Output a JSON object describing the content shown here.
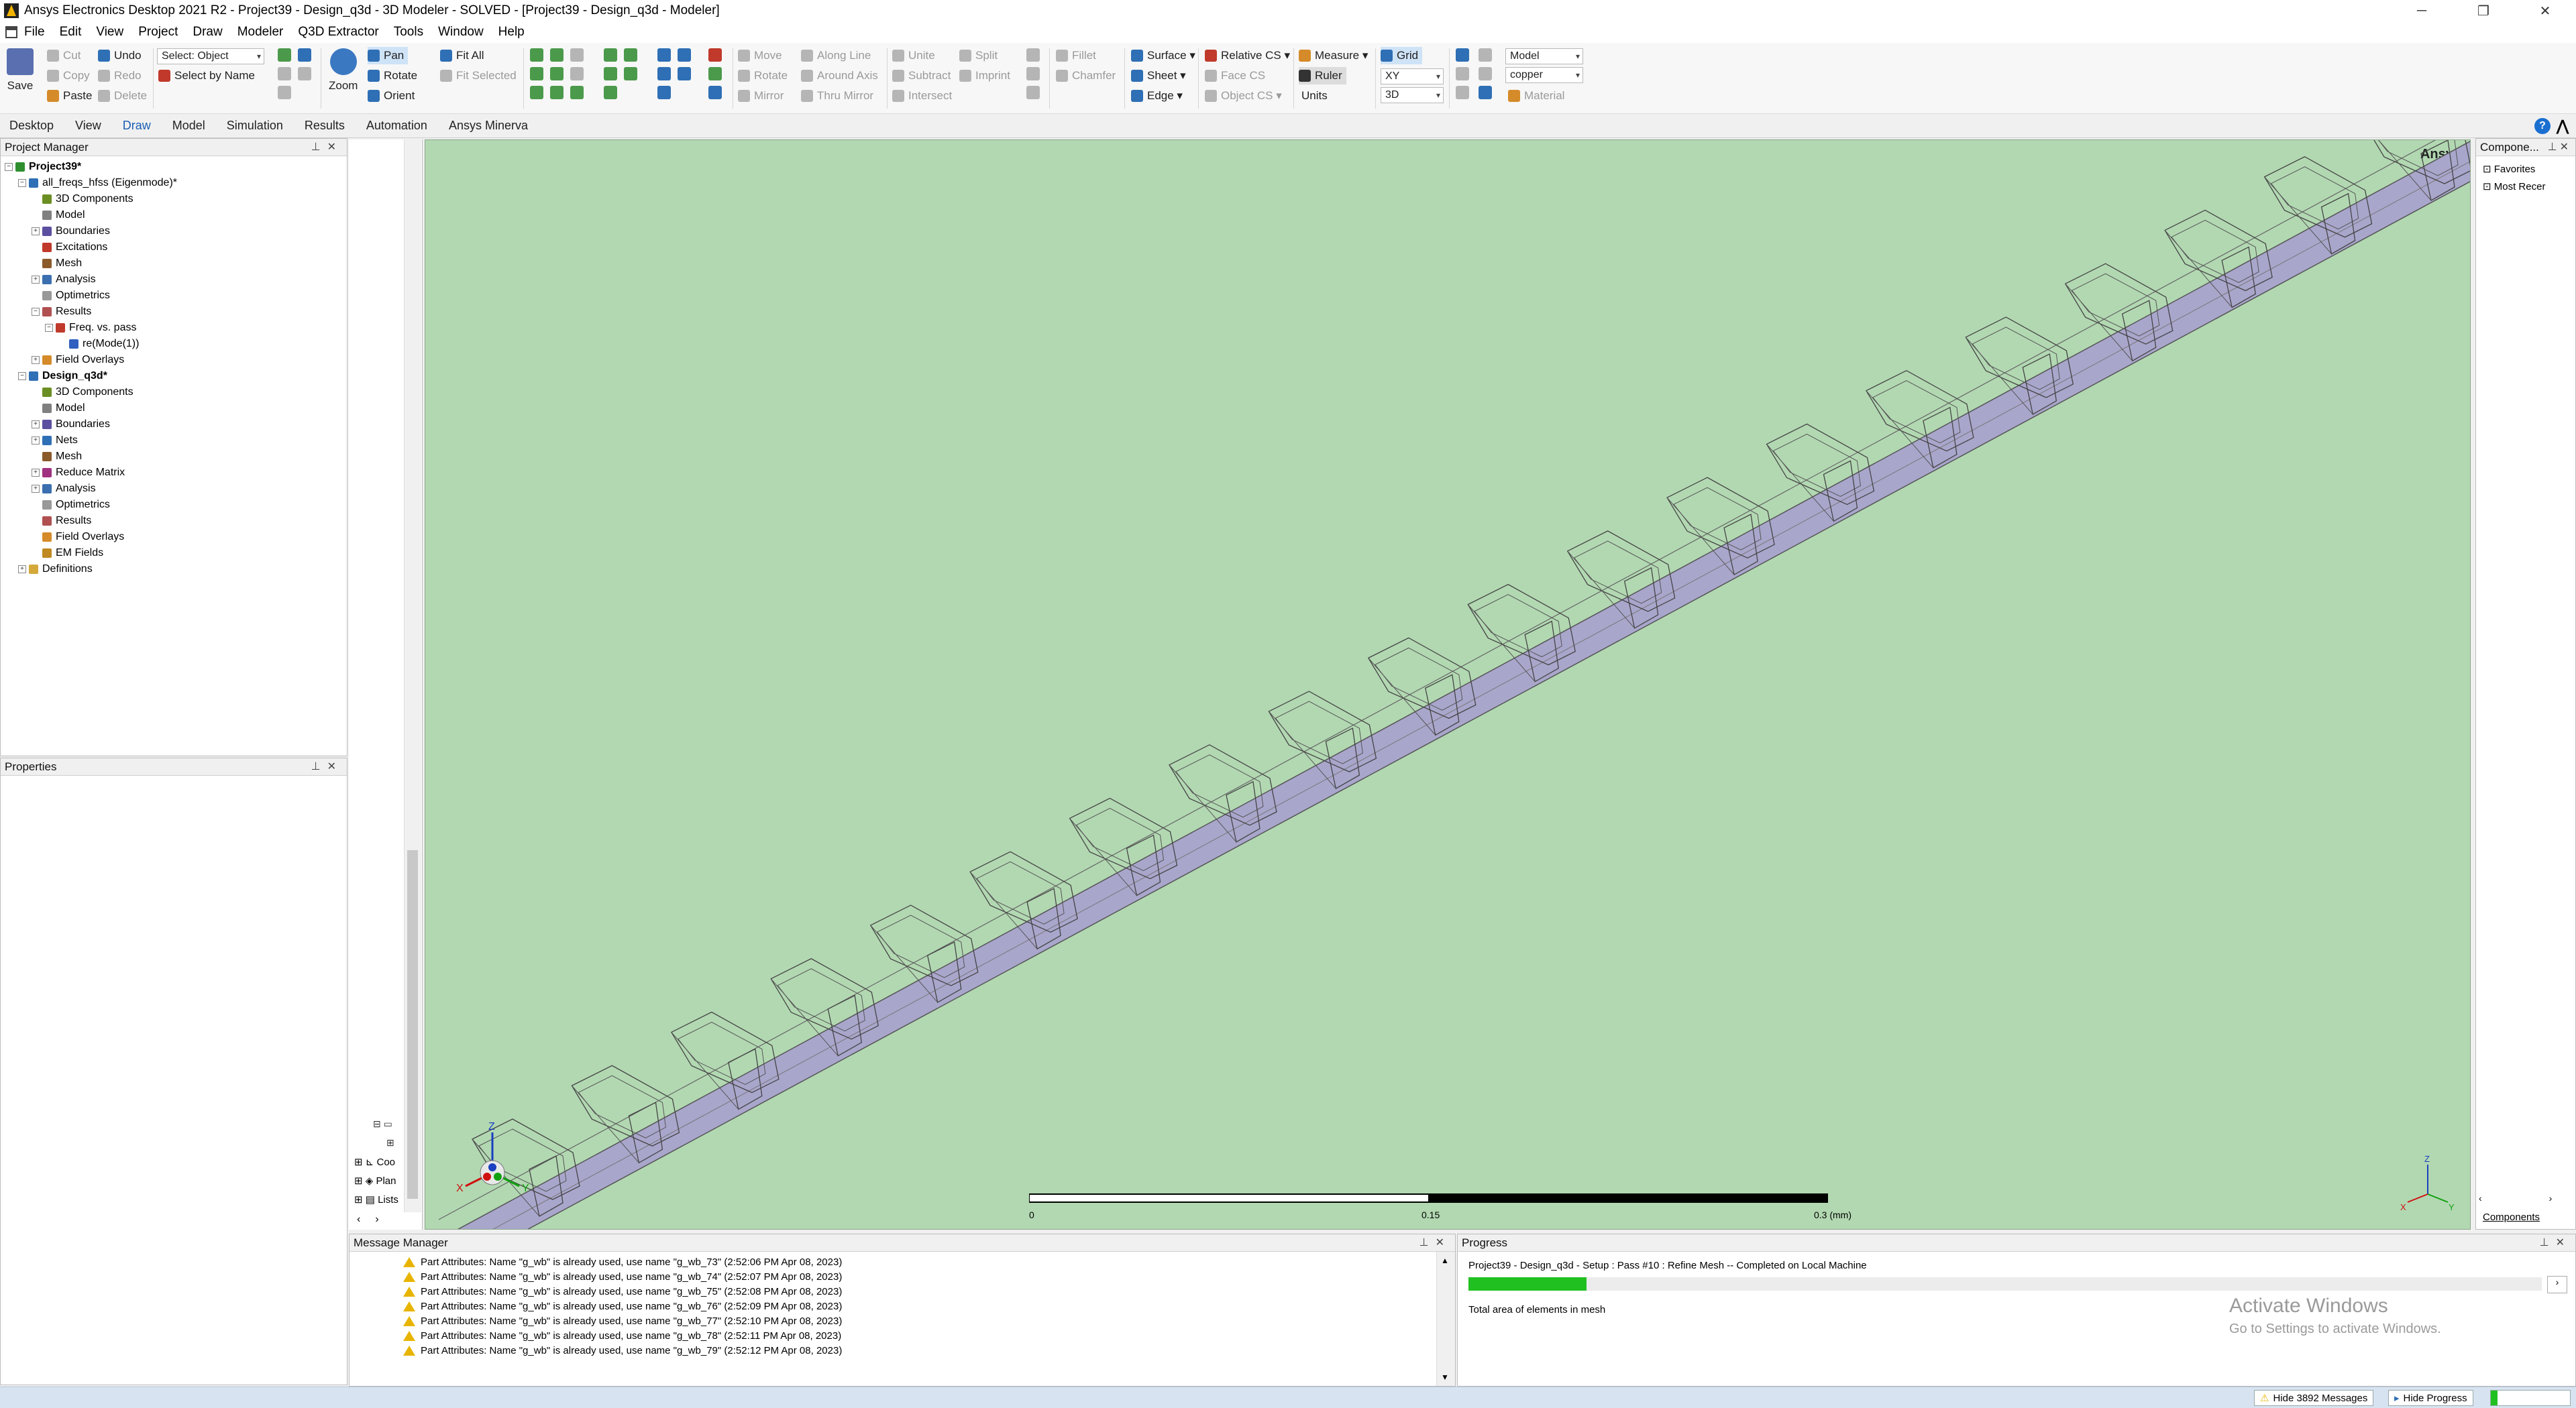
{
  "window": {
    "title": "Ansys Electronics Desktop 2021 R2 - Project39 - Design_q3d - 3D Modeler - SOLVED - [Project39 - Design_q3d - Modeler]",
    "controls": [
      "─",
      "❐",
      "✕"
    ]
  },
  "menu": [
    "File",
    "Edit",
    "View",
    "Project",
    "Draw",
    "Modeler",
    "Q3D Extractor",
    "Tools",
    "Window",
    "Help"
  ],
  "ribbon": {
    "save": "Save",
    "cut": "Cut",
    "copy": "Copy",
    "paste": "Paste",
    "undo": "Undo",
    "redo": "Redo",
    "delete": "Delete",
    "select_mode": "Select: Object",
    "select_by_name": "Select by Name",
    "zoom": "Zoom",
    "pan": "Pan",
    "rotate": "Rotate",
    "orient": "Orient",
    "fit_all": "Fit All",
    "fit_selected": "Fit Selected",
    "move": "Move",
    "rotate2": "Rotate",
    "mirror": "Mirror",
    "along_line": "Along Line",
    "around_axis": "Around Axis",
    "thru_mirror": "Thru Mirror",
    "unite": "Unite",
    "subtract": "Subtract",
    "intersect": "Intersect",
    "split": "Split",
    "imprint": "Imprint",
    "fillet": "Fillet",
    "chamfer": "Chamfer",
    "surface": "Surface",
    "sheet": "Sheet",
    "edge": "Edge",
    "relative_cs": "Relative CS",
    "face_cs": "Face CS",
    "object_cs": "Object CS",
    "measure": "Measure",
    "ruler": "Ruler",
    "units": "Units",
    "grid": "Grid",
    "plane": "XY",
    "view_mode": "3D",
    "model": "Model",
    "material_value": "copper",
    "material": "Material"
  },
  "tabs": [
    "Desktop",
    "View",
    "Draw",
    "Model",
    "Simulation",
    "Results",
    "Automation",
    "Ansys Minerva"
  ],
  "active_tab": "Draw",
  "project_manager": {
    "title": "Project Manager",
    "items": [
      {
        "label": "Project39*",
        "depth": 0,
        "icon": "#2f8f2f",
        "bold": true,
        "exp": "⊟"
      },
      {
        "label": "all_freqs_hfss (Eigenmode)*",
        "depth": 1,
        "icon": "#2f6fb5",
        "exp": "⊟"
      },
      {
        "label": "3D Components",
        "depth": 2,
        "icon": "#6b8e23",
        "exp": ""
      },
      {
        "label": "Model",
        "depth": 2,
        "icon": "#808080",
        "exp": ""
      },
      {
        "label": "Boundaries",
        "depth": 2,
        "icon": "#5b4fa0",
        "exp": "⊞"
      },
      {
        "label": "Excitations",
        "depth": 2,
        "icon": "#c0392b",
        "exp": ""
      },
      {
        "label": "Mesh",
        "depth": 2,
        "icon": "#8b5a2b",
        "exp": ""
      },
      {
        "label": "Analysis",
        "depth": 2,
        "icon": "#3b6fb0",
        "exp": "⊞"
      },
      {
        "label": "Optimetrics",
        "depth": 2,
        "icon": "#999999",
        "exp": ""
      },
      {
        "label": "Results",
        "depth": 2,
        "icon": "#b05050",
        "exp": "⊟"
      },
      {
        "label": "Freq. vs. pass",
        "depth": 3,
        "icon": "#c0392b",
        "exp": "⊟"
      },
      {
        "label": "re(Mode(1))",
        "depth": 4,
        "icon": "#3060c0",
        "exp": ""
      },
      {
        "label": "Field Overlays",
        "depth": 2,
        "icon": "#d58b2a",
        "exp": "⊞"
      },
      {
        "label": "Design_q3d*",
        "depth": 1,
        "icon": "#2f6fb5",
        "bold": true,
        "exp": "⊟"
      },
      {
        "label": "3D Components",
        "depth": 2,
        "icon": "#6b8e23",
        "exp": ""
      },
      {
        "label": "Model",
        "depth": 2,
        "icon": "#808080",
        "exp": ""
      },
      {
        "label": "Boundaries",
        "depth": 2,
        "icon": "#5b4fa0",
        "exp": "⊞"
      },
      {
        "label": "Nets",
        "depth": 2,
        "icon": "#2f6fb5",
        "exp": "⊞"
      },
      {
        "label": "Mesh",
        "depth": 2,
        "icon": "#8b5a2b",
        "exp": ""
      },
      {
        "label": "Reduce Matrix",
        "depth": 2,
        "icon": "#a03080",
        "exp": "⊞"
      },
      {
        "label": "Analysis",
        "depth": 2,
        "icon": "#3b6fb0",
        "exp": "⊞"
      },
      {
        "label": "Optimetrics",
        "depth": 2,
        "icon": "#999999",
        "exp": ""
      },
      {
        "label": "Results",
        "depth": 2,
        "icon": "#b05050",
        "exp": ""
      },
      {
        "label": "Field Overlays",
        "depth": 2,
        "icon": "#d58b2a",
        "exp": ""
      },
      {
        "label": "EM Fields",
        "depth": 2,
        "icon": "#c08a20",
        "exp": ""
      },
      {
        "label": "Definitions",
        "depth": 1,
        "icon": "#d4a93a",
        "exp": "⊞"
      }
    ]
  },
  "properties": {
    "title": "Properties"
  },
  "left_strip": {
    "items": [
      "Coo",
      "Plan",
      "Lists"
    ]
  },
  "viewport": {
    "brand": "Ansys",
    "scale_labels": [
      "0",
      "0.15",
      "0.3 (mm)"
    ],
    "axis_labels": [
      "X",
      "Y",
      "Z"
    ]
  },
  "components": {
    "title": "Compone...",
    "items": [
      "Favorites",
      "Most Recer"
    ],
    "tab": "Components"
  },
  "message_manager": {
    "title": "Message Manager",
    "messages": [
      "Part Attributes: Name \"g_wb\" is already used, use name \"g_wb_73\" (2:52:06 PM  Apr 08, 2023)",
      "Part Attributes: Name \"g_wb\" is already used, use name \"g_wb_74\" (2:52:07 PM  Apr 08, 2023)",
      "Part Attributes: Name \"g_wb\" is already used, use name \"g_wb_75\" (2:52:08 PM  Apr 08, 2023)",
      "Part Attributes: Name \"g_wb\" is already used, use name \"g_wb_76\" (2:52:09 PM  Apr 08, 2023)",
      "Part Attributes: Name \"g_wb\" is already used, use name \"g_wb_77\" (2:52:10 PM  Apr 08, 2023)",
      "Part Attributes: Name \"g_wb\" is already used, use name \"g_wb_78\" (2:52:11 PM  Apr 08, 2023)",
      "Part Attributes: Name \"g_wb\" is already used, use name \"g_wb_79\" (2:52:12 PM  Apr 08, 2023)"
    ]
  },
  "progress": {
    "title": "Progress",
    "task": "Project39 - Design_q3d - Setup : Pass #10 : Refine Mesh -- Completed on Local Machine",
    "fraction": 0.11,
    "detail": "Total area of elements in mesh",
    "watermark_title": "Activate Windows",
    "watermark_sub": "Go to Settings to activate Windows."
  },
  "statusbar": {
    "hide_messages": "Hide 3892 Messages",
    "hide_progress": "Hide Progress"
  },
  "colors": {
    "viewport_bg": "#b2d8b2",
    "trace_fill": "#a9a6cc",
    "progress_green": "#21c021"
  }
}
